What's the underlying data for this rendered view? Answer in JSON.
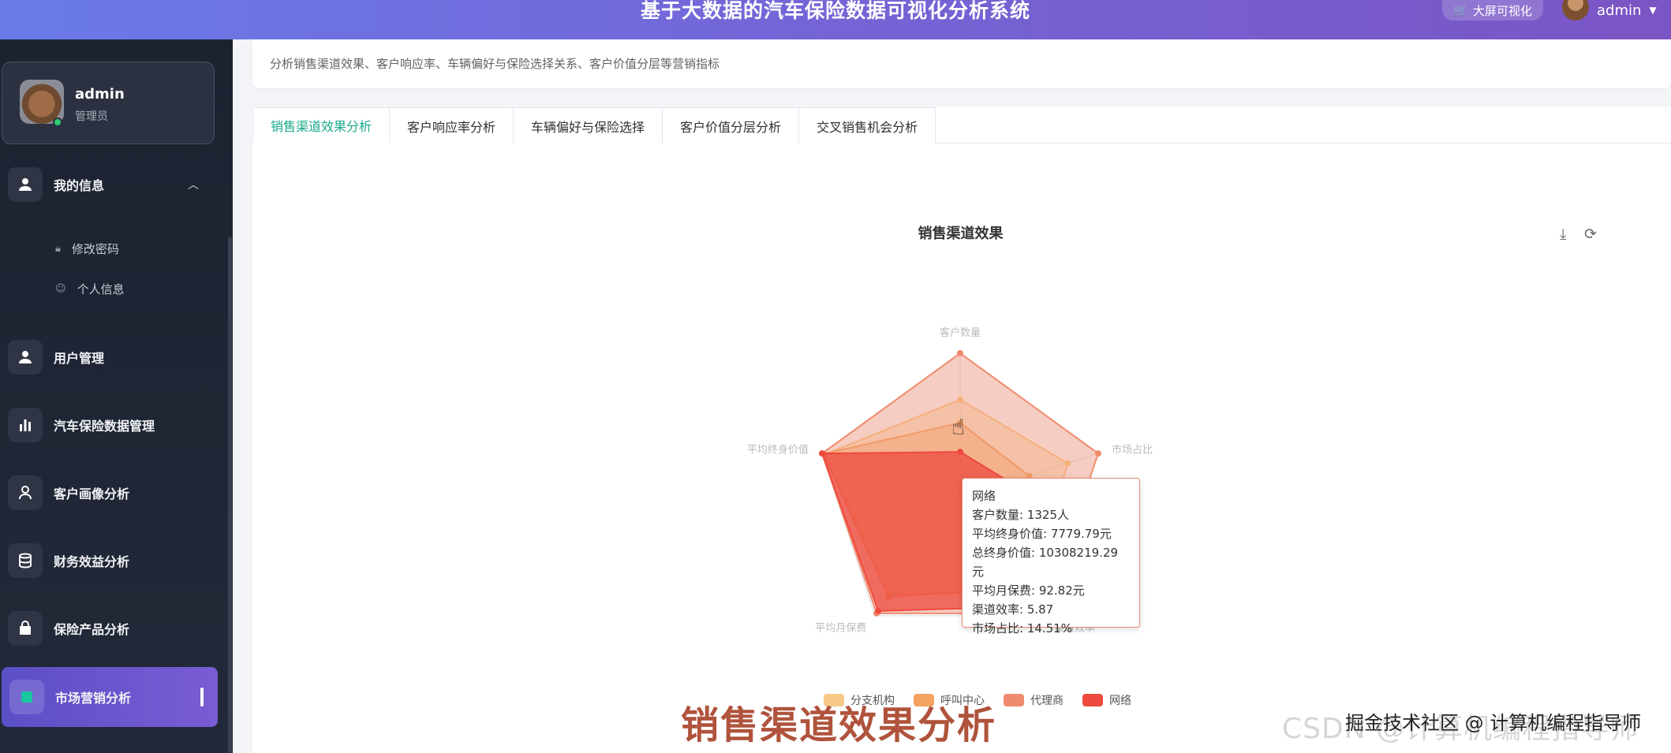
{
  "header": {
    "title": "基于大数据的汽车保险数据可视化分析系统",
    "bigscreen_label": "大屏可视化",
    "username": "admin"
  },
  "sidebar": {
    "user": {
      "name": "admin",
      "role": "管理员"
    },
    "items": [
      {
        "label": "我的信息",
        "icon": "user-icon",
        "expanded": true
      },
      {
        "label": "用户管理",
        "icon": "user-icon"
      },
      {
        "label": "汽车保险数据管理",
        "icon": "bar-chart-icon"
      },
      {
        "label": "客户画像分析",
        "icon": "person-icon"
      },
      {
        "label": "财务效益分析",
        "icon": "database-icon"
      },
      {
        "label": "保险产品分析",
        "icon": "bag-icon"
      },
      {
        "label": "市场营销分析",
        "icon": "square-icon",
        "active": true
      }
    ],
    "subitems": [
      {
        "label": "修改密码",
        "icon": "lock-icon"
      },
      {
        "label": "个人信息",
        "icon": "user-outline-icon"
      }
    ]
  },
  "page": {
    "description": "分析销售渠道效果、客户响应率、车辆偏好与保险选择关系、客户价值分层等营销指标",
    "tabs": [
      "销售渠道效果分析",
      "客户响应率分析",
      "车辆偏好与保险选择",
      "客户价值分层分析",
      "交叉销售机会分析"
    ],
    "active_tab": 0
  },
  "chart_data": {
    "type": "radar",
    "title": "销售渠道效果",
    "indicators": [
      "客户数量",
      "市场占比",
      "渠道效率",
      "平均月保费",
      "平均终身价值"
    ],
    "series": [
      {
        "name": "分支机构",
        "color": "#f7c987",
        "values": [
          0.68,
          0.78,
          0.8,
          0.82,
          0.98
        ]
      },
      {
        "name": "呼叫中心",
        "color": "#f3a35f",
        "values": [
          0.52,
          0.5,
          0.76,
          0.84,
          0.99
        ]
      },
      {
        "name": "代理商",
        "color": "#f08a6e",
        "values": [
          1.0,
          1.0,
          0.98,
          0.98,
          1.0
        ]
      },
      {
        "name": "网络",
        "color": "#ee4a3e",
        "values": [
          0.32,
          0.36,
          0.92,
          0.96,
          1.0
        ]
      }
    ],
    "legend": [
      "分支机构",
      "呼叫中心",
      "代理商",
      "网络"
    ],
    "legend_position": "bottom"
  },
  "tooltip": {
    "title": "网络",
    "lines": [
      "客户数量: 1325人",
      "平均终身价值: 7779.79元",
      "总终身价值: 10308219.29元",
      "平均月保费: 92.82元",
      "渠道效率: 5.87",
      "市场占比: 14.51%"
    ]
  },
  "overlay": {
    "caption": "销售渠道效果分析",
    "watermark": "CSDN @计算机编程指导师",
    "watermark2": "掘金技术社区 @ 计算机编程指导师"
  },
  "toolbox": {
    "download_icon": "download-icon",
    "refresh_icon": "refresh-icon"
  }
}
